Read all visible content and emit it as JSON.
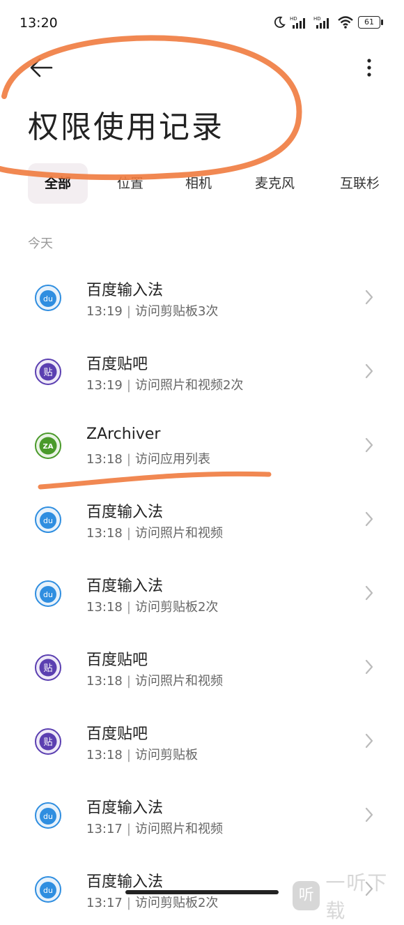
{
  "status_bar": {
    "time": "13:20",
    "battery": "61",
    "hd1": "HD",
    "hd2": "HD"
  },
  "header": {
    "title": "权限使用记录"
  },
  "tabs": [
    {
      "label": "全部"
    },
    {
      "label": "位置"
    },
    {
      "label": "相机"
    },
    {
      "label": "麦克风"
    },
    {
      "label": "互联杉"
    }
  ],
  "section": {
    "label": "今天"
  },
  "items": [
    {
      "app": "百度输入法",
      "time": "13:19",
      "sep": "|",
      "action": "访问剪贴板3次",
      "icon": "baidu-input-icon"
    },
    {
      "app": "百度贴吧",
      "time": "13:19",
      "sep": "|",
      "action": "访问照片和视频2次",
      "icon": "baidu-tieba-icon"
    },
    {
      "app": "ZArchiver",
      "time": "13:18",
      "sep": "|",
      "action": "访问应用列表",
      "icon": "zarchiver-icon"
    },
    {
      "app": "百度输入法",
      "time": "13:18",
      "sep": "|",
      "action": "访问照片和视频",
      "icon": "baidu-input-icon"
    },
    {
      "app": "百度输入法",
      "time": "13:18",
      "sep": "|",
      "action": "访问剪贴板2次",
      "icon": "baidu-input-icon"
    },
    {
      "app": "百度贴吧",
      "time": "13:18",
      "sep": "|",
      "action": "访问照片和视频",
      "icon": "baidu-tieba-icon"
    },
    {
      "app": "百度贴吧",
      "time": "13:18",
      "sep": "|",
      "action": "访问剪贴板",
      "icon": "baidu-tieba-icon"
    },
    {
      "app": "百度输入法",
      "time": "13:17",
      "sep": "|",
      "action": "访问照片和视频",
      "icon": "baidu-input-icon"
    },
    {
      "app": "百度输入法",
      "time": "13:17",
      "sep": "|",
      "action": "访问剪贴板2次",
      "icon": "baidu-input-icon"
    }
  ],
  "icons": {
    "baidu_input_text": "du",
    "baidu_tieba_text": "贴",
    "zarchiver_text": "ZA"
  },
  "watermark": {
    "logo": "听",
    "text": "一听下载"
  },
  "colors": {
    "annotation": "#f07b3f",
    "baidu_input_blue": "#2f8ee0",
    "tieba_purple": "#5b3fb1",
    "zarchiver_green": "#4a9a2a"
  }
}
